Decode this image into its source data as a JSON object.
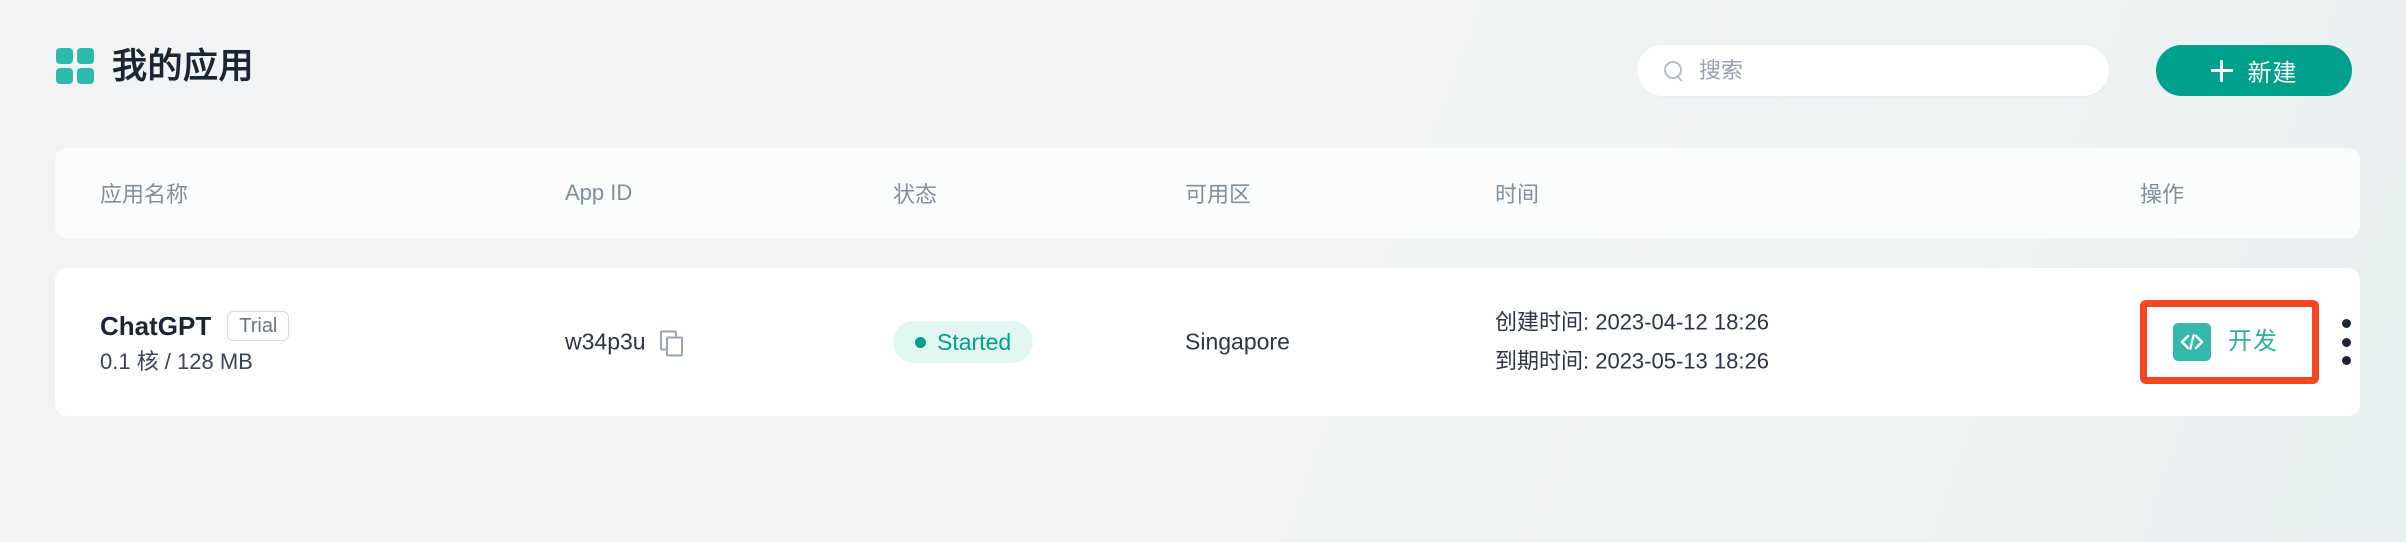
{
  "header": {
    "title": "我的应用",
    "grid_icon": "grid-icon",
    "search": {
      "placeholder": "搜索",
      "value": "",
      "icon": "search-icon"
    },
    "new_button": {
      "label": "新建",
      "icon": "plus-icon"
    }
  },
  "table": {
    "columns": [
      {
        "key": "name",
        "label": "应用名称"
      },
      {
        "key": "appid",
        "label": "App ID"
      },
      {
        "key": "status",
        "label": "状态"
      },
      {
        "key": "zone",
        "label": "可用区"
      },
      {
        "key": "time",
        "label": "时间"
      },
      {
        "key": "action",
        "label": "操作"
      }
    ],
    "rows": [
      {
        "name": "ChatGPT",
        "badge": "Trial",
        "spec": "0.1 核 / 128 MB",
        "app_id": "w34p3u",
        "copy_icon": "copy-icon",
        "status": "Started",
        "zone": "Singapore",
        "created_time": "创建时间: 2023-04-12 18:26",
        "expire_time": "到期时间: 2023-05-13 18:26",
        "action": {
          "develop_label": "开发",
          "develop_icon": "code-icon",
          "more_icon": "kebab-menu-icon"
        }
      }
    ]
  },
  "colors": {
    "accent": "#00a08c",
    "accent_light": "#2eb9ad",
    "status_text": "#00a08c",
    "status_bg": "#e2f6f2",
    "highlight": "#f5461f",
    "page_bg": "#f1f3f5",
    "card_bg": "#ffffff",
    "header_card_bg": "#fbfcfc",
    "muted_text": "#838e9c"
  }
}
